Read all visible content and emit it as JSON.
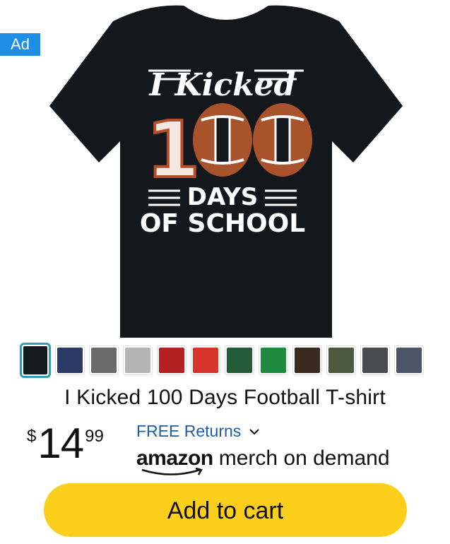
{
  "ad": {
    "label": "Ad"
  },
  "product": {
    "image_text": {
      "line1": "I Kicked",
      "number": "100",
      "line2": "DAYS",
      "line3": "OF SCHOOL"
    },
    "title": "I Kicked 100 Days Football T-shirt",
    "price": {
      "symbol": "$",
      "whole": "14",
      "fraction": "99"
    },
    "returns": {
      "label": "FREE Returns",
      "icon": "chevron-down-icon"
    },
    "seller": {
      "brand": "amazon",
      "label": "merch on demand"
    }
  },
  "swatches": [
    {
      "color": "#15181c",
      "selected": true
    },
    {
      "color": "#2b3a66",
      "selected": false
    },
    {
      "color": "#6b6b6b",
      "selected": false
    },
    {
      "color": "#b5b5b5",
      "selected": false
    },
    {
      "color": "#b22222",
      "selected": false
    },
    {
      "color": "#d8342b",
      "selected": false
    },
    {
      "color": "#235b38",
      "selected": false
    },
    {
      "color": "#1f8b3f",
      "selected": false
    },
    {
      "color": "#3b2a20",
      "selected": false
    },
    {
      "color": "#4b5a3d",
      "selected": false
    },
    {
      "color": "#4a4c50",
      "selected": false
    },
    {
      "color": "#4c5566",
      "selected": false
    }
  ],
  "cart": {
    "label": "Add to cart"
  },
  "colors": {
    "accent": "#fccf1c",
    "link": "#1a5fa7",
    "ad_badge": "#1f8fe6",
    "selected_border": "#2e9fb4"
  }
}
